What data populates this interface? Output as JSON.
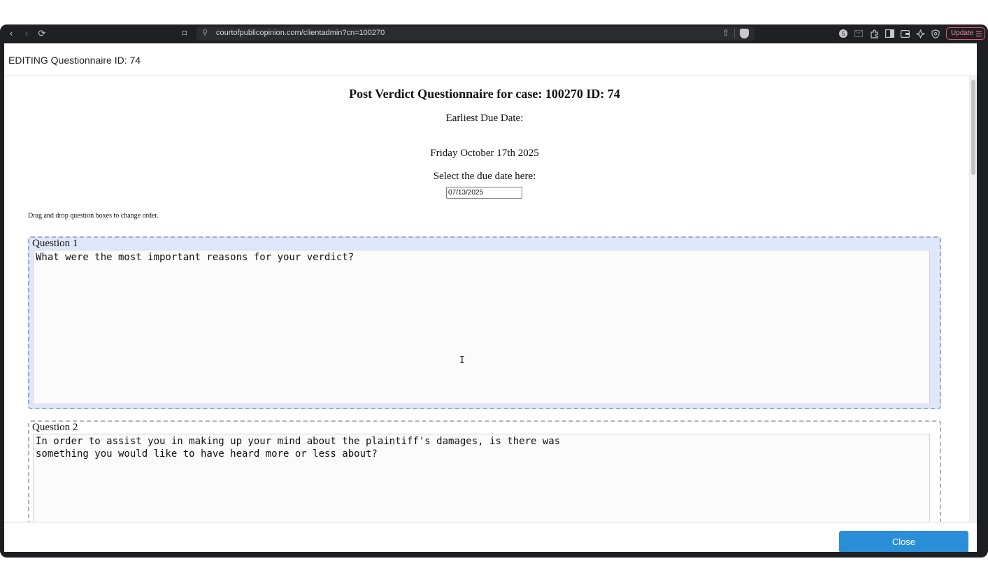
{
  "browser": {
    "url": "courtofpublicopinion.com/clientadmin?cn=100270",
    "update_label": "Update",
    "icons": {
      "back": "‹",
      "forward": "›",
      "reload": "⟳",
      "bookmark": "⌑",
      "site_settings": "⚲",
      "share": "⇧",
      "menu": "☰"
    }
  },
  "modal": {
    "title": "EDITING Questionnaire ID: 74",
    "close_label": "Close"
  },
  "questionnaire": {
    "heading": "Post Verdict Questionnaire for case: 100270 ID: 74",
    "earliest_label": "Earliest Due Date:",
    "earliest_date": "Friday October 17th 2025",
    "select_label": "Select the due date here:",
    "due_date_value": "07/13/2025",
    "drag_hint": "Drag and drop question boxes to change order.",
    "questions": [
      {
        "label": "Question 1",
        "text": "What were the most important reasons for your verdict?"
      },
      {
        "label": "Question 2",
        "text": "In order to assist you in making up your mind about the plaintiff's damages, is there was\nsomething you would like to have heard more or less about?"
      }
    ]
  },
  "colors": {
    "accent": "#2b8ed8",
    "active_question_bg": "#dfe8fa",
    "browser_chrome": "#1f2023"
  }
}
